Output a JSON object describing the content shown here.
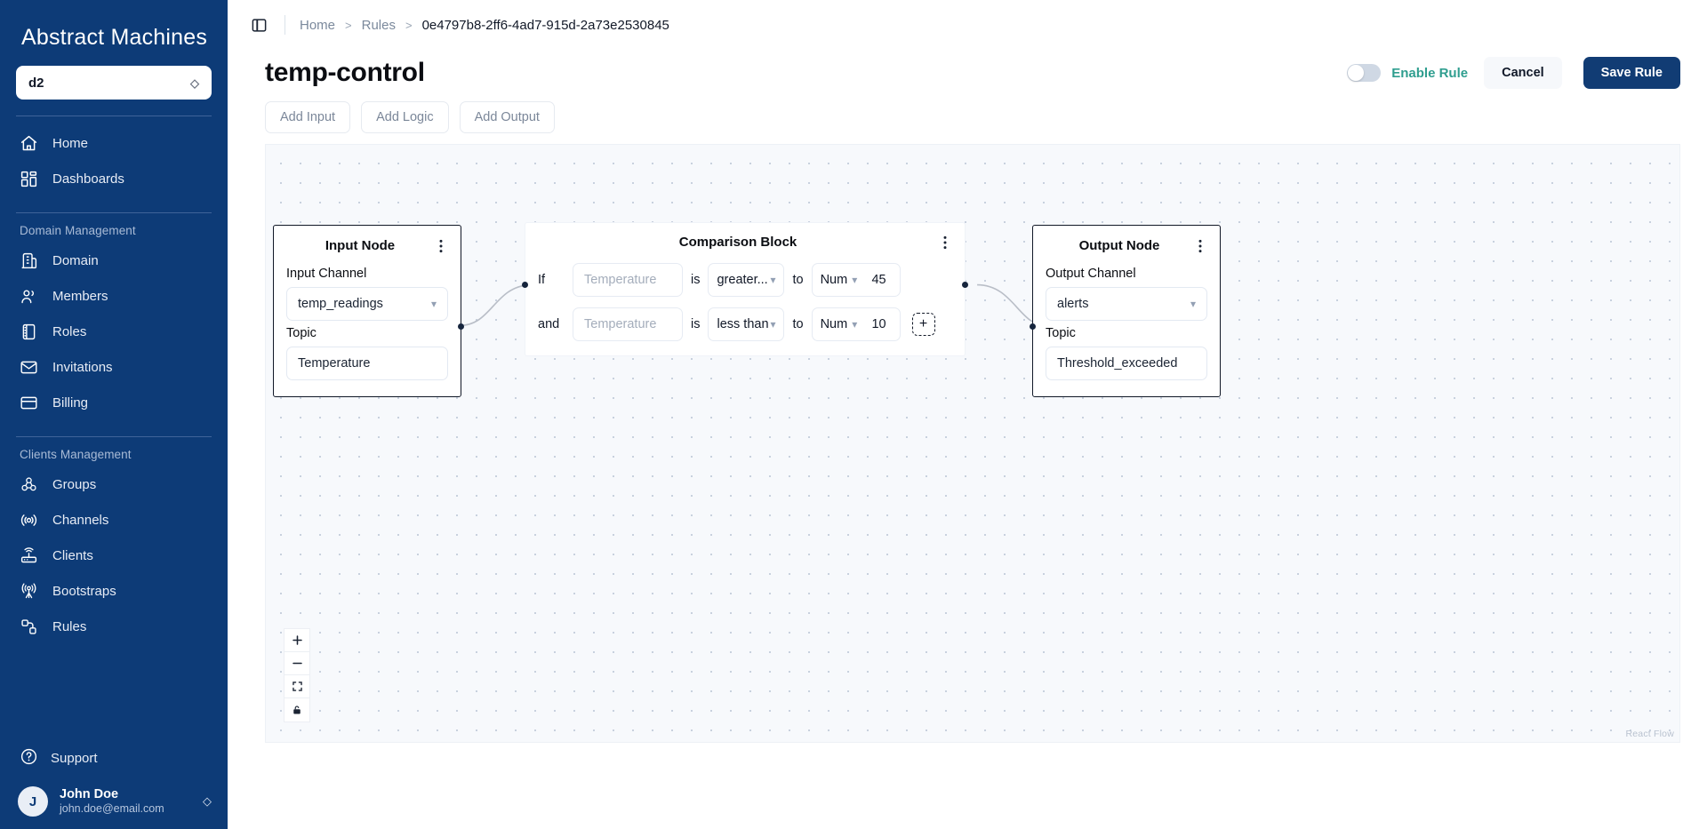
{
  "sidebar": {
    "brand": "Abstract Machines",
    "domain_selector": {
      "value": "d2"
    },
    "nav_top": [
      {
        "label": "Home",
        "icon": "home-icon"
      },
      {
        "label": "Dashboards",
        "icon": "dashboards-icon"
      }
    ],
    "section_domain": "Domain Management",
    "nav_domain": [
      {
        "label": "Domain",
        "icon": "building-icon"
      },
      {
        "label": "Members",
        "icon": "users-icon"
      },
      {
        "label": "Roles",
        "icon": "book-icon"
      },
      {
        "label": "Invitations",
        "icon": "envelope-icon"
      },
      {
        "label": "Billing",
        "icon": "credit-card-icon"
      }
    ],
    "section_clients": "Clients Management",
    "nav_clients": [
      {
        "label": "Groups",
        "icon": "groups-icon"
      },
      {
        "label": "Channels",
        "icon": "broadcast-icon"
      },
      {
        "label": "Clients",
        "icon": "router-icon"
      },
      {
        "label": "Bootstraps",
        "icon": "antenna-icon"
      },
      {
        "label": "Rules",
        "icon": "rules-icon"
      }
    ],
    "support": {
      "label": "Support",
      "icon": "question-circle-icon"
    },
    "user": {
      "initial": "J",
      "name": "John Doe",
      "email": "john.doe@email.com"
    }
  },
  "topbar": {
    "panel_toggle_icon": "panel-left-icon",
    "breadcrumb": [
      {
        "label": "Home",
        "current": false
      },
      {
        "label": "Rules",
        "current": false
      },
      {
        "label": "0e4797b8-2ff6-4ad7-915d-2a73e2530845",
        "current": true
      }
    ],
    "separator": ">"
  },
  "header": {
    "title": "temp-control",
    "enable_rule_label": "Enable Rule",
    "enable_rule_on": false,
    "cancel_label": "Cancel",
    "save_label": "Save Rule"
  },
  "toolbar": {
    "add_input": "Add Input",
    "add_logic": "Add Logic",
    "add_output": "Add Output"
  },
  "canvas": {
    "attribution": "React Flow",
    "controls": [
      {
        "name": "zoom-in",
        "glyph": "+"
      },
      {
        "name": "zoom-out",
        "glyph": "−"
      },
      {
        "name": "fit-view",
        "glyph": "fit"
      },
      {
        "name": "lock",
        "glyph": "lock"
      }
    ],
    "input_node": {
      "title": "Input Node",
      "channel_label": "Input Channel",
      "channel_value": "temp_readings",
      "topic_label": "Topic",
      "topic_value": "Temperature"
    },
    "comparison_block": {
      "title": "Comparison Block",
      "add_condition_glyph": "+",
      "rows": [
        {
          "connector": "If",
          "field_placeholder": "Temperature",
          "is_label": "is",
          "operator": "greater...",
          "to_label": "to",
          "value_type": "Num",
          "value": "45"
        },
        {
          "connector": "and",
          "field_placeholder": "Temperature",
          "is_label": "is",
          "operator": "less than",
          "to_label": "to",
          "value_type": "Num",
          "value": "10"
        }
      ]
    },
    "output_node": {
      "title": "Output Node",
      "channel_label": "Output Channel",
      "channel_value": "alerts",
      "topic_label": "Topic",
      "topic_value": "Threshold_exceeded"
    }
  },
  "colors": {
    "sidebar_bg": "#0d3b77",
    "accent_teal": "#2f9e8f",
    "save_button": "#113c74",
    "canvas_bg": "#f7f9fc"
  }
}
